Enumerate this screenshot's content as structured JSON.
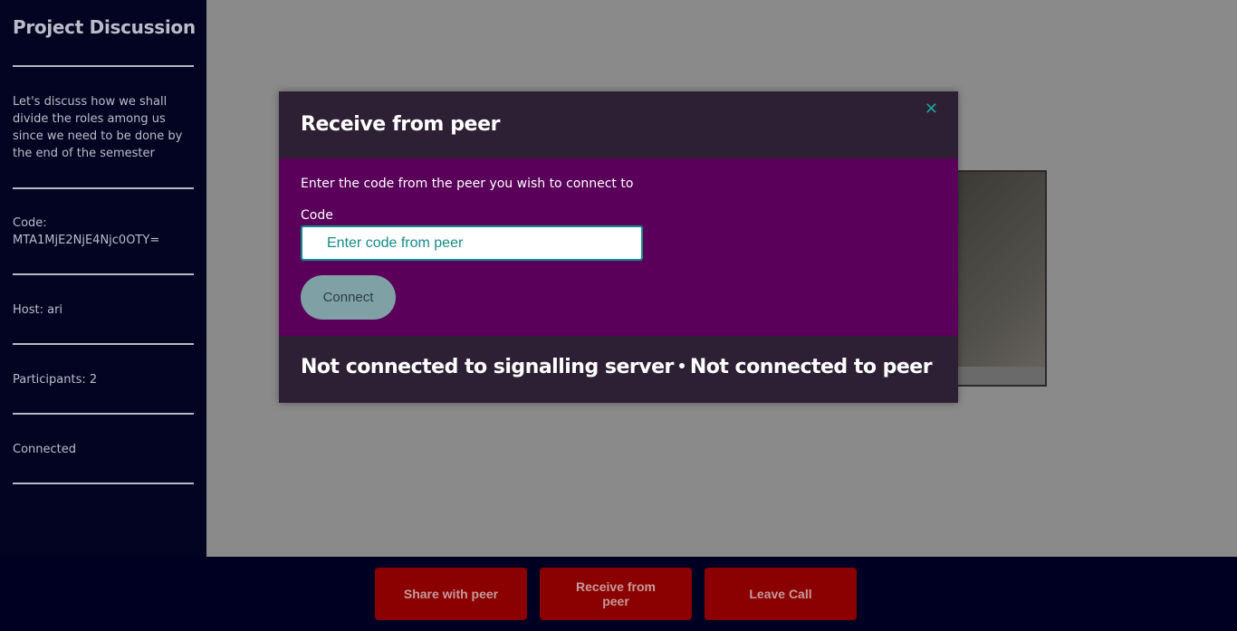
{
  "sidebar": {
    "title": "Project Discussion",
    "description": "Let's discuss how we shall divide the roles among us since we need to be done by the end of the semester",
    "code_label": "Code:",
    "code_value": "MTA1MjE2NjE4Njc0OTY=",
    "host": "Host: ari",
    "participants": "Participants: 2",
    "status": "Connected"
  },
  "modal": {
    "title": "Receive from peer",
    "close_icon": "close-icon",
    "instruction": "Enter the code from the peer you wish to connect to",
    "code_label": "Code",
    "code_placeholder": "Enter code from peer",
    "code_value": "",
    "connect_label": "Connect",
    "status_server": "Not connected to signalling server",
    "status_peer": "Not connected to peer"
  },
  "controls": {
    "share_label": "Share with peer",
    "receive_label": "Receive from peer",
    "leave_label": "Leave Call"
  },
  "colors": {
    "sidebar_bg": "#030322",
    "modal_body_bg": "#5a005a",
    "modal_head_bg": "#2e2034",
    "accent": "#0f8f8a",
    "control_button_bg": "#8b0000"
  }
}
